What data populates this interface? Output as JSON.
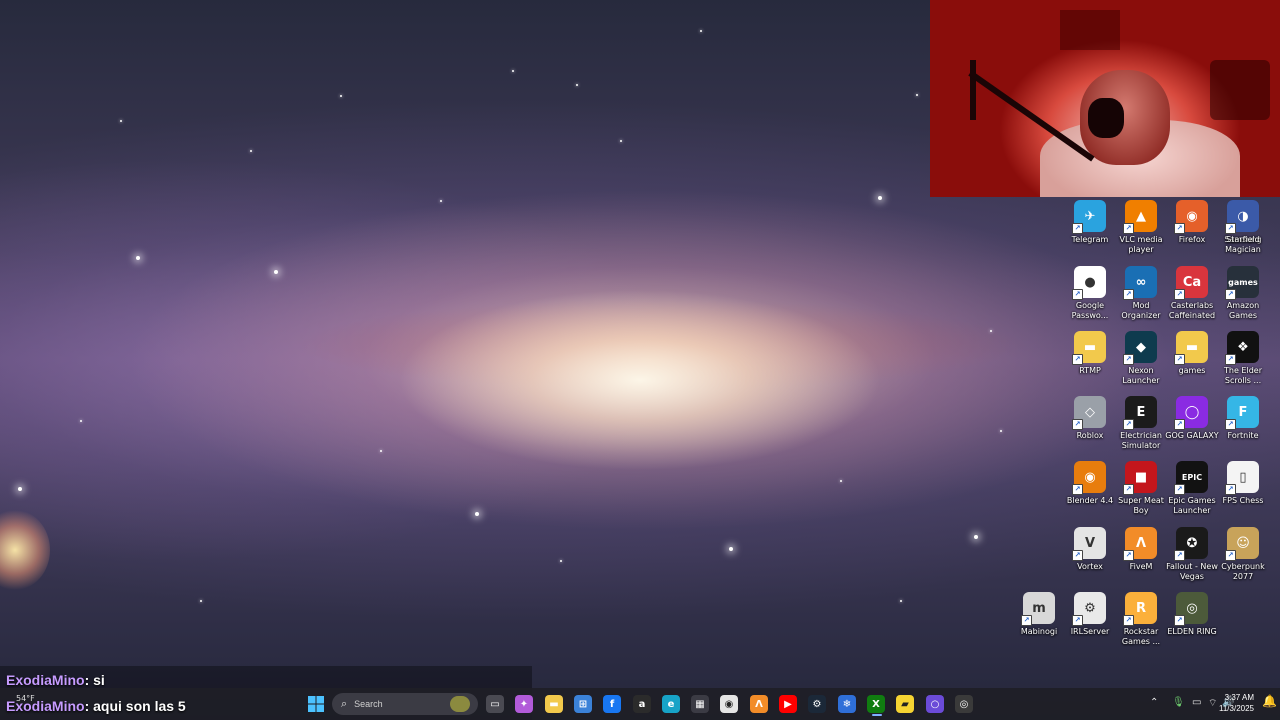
{
  "desktop": {
    "icons": [
      {
        "label": "Telegram",
        "color": "#2aa3df",
        "glyph": "✈"
      },
      {
        "label": "VLC media player",
        "color": "#f07f00",
        "glyph": "▲"
      },
      {
        "label": "Firefox",
        "color": "#e5602a",
        "glyph": "◉"
      },
      {
        "label": "Samsung Magician",
        "color": "#1b2540",
        "glyph": "○"
      },
      {
        "label": "Google Passwo...",
        "color": "#ffffff",
        "glyph": "●"
      },
      {
        "label": "Mod Organizer",
        "color": "#1a6fb4",
        "glyph": "∞"
      },
      {
        "label": "Casterlabs Caffeinated",
        "color": "#d9353d",
        "glyph": "Ca"
      },
      {
        "label": "Amazon Games",
        "color": "#27303b",
        "glyph": "games"
      },
      {
        "label": "RTMP",
        "color": "#f2c94c",
        "glyph": "▬"
      },
      {
        "label": "Nexon Launcher",
        "color": "#0e3b4e",
        "glyph": "◆"
      },
      {
        "label": "games",
        "color": "#f2c94c",
        "glyph": "▬"
      },
      {
        "label": "The Elder Scrolls ...",
        "color": "#111111",
        "glyph": "❖"
      },
      {
        "label": "Roblox",
        "color": "#9aa0a8",
        "glyph": "◇"
      },
      {
        "label": "Electrician Simulator",
        "color": "#1b1b1b",
        "glyph": "E"
      },
      {
        "label": "GOG GALAXY",
        "color": "#8a2be2",
        "glyph": "◯"
      },
      {
        "label": "Fortnite",
        "color": "#35b6e6",
        "glyph": "F"
      },
      {
        "label": "Blender 4.4",
        "color": "#e87d0d",
        "glyph": "◉"
      },
      {
        "label": "Super Meat Boy",
        "color": "#c4161c",
        "glyph": "■"
      },
      {
        "label": "Epic Games Launcher",
        "color": "#121212",
        "glyph": "EPIC"
      },
      {
        "label": "FPS Chess",
        "color": "#f4f4f4",
        "glyph": "▯"
      },
      {
        "label": "Vortex",
        "color": "#e4e4e4",
        "glyph": "V"
      },
      {
        "label": "FiveM",
        "color": "#f28c28",
        "glyph": "Λ"
      },
      {
        "label": "Fallout - New Vegas",
        "color": "#1a1a1a",
        "glyph": "✪"
      },
      {
        "label": "Cyberpunk 2077",
        "color": "#c8a35a",
        "glyph": "☺"
      },
      {
        "label": "Mabinogi",
        "color": "#d8d8d8",
        "glyph": "m"
      },
      {
        "label": "IRLServer",
        "color": "#e9e9e9",
        "glyph": "⚙"
      },
      {
        "label": "Rockstar Games ...",
        "color": "#fbb03b",
        "glyph": "R"
      },
      {
        "label": "ELDEN RING",
        "color": "#4c5a3a",
        "glyph": "◎"
      },
      {
        "label": "Starfield",
        "color": "#3b5aa8",
        "glyph": "◑"
      }
    ]
  },
  "chat": {
    "lines": [
      {
        "user": "ExodiaMino",
        "msg": ": si"
      },
      {
        "user": "ExodiaMino",
        "msg": ": aqui son las 5"
      }
    ]
  },
  "taskbar": {
    "weather": "54°F",
    "search_placeholder": "Search",
    "apps": [
      {
        "name": "task-view",
        "color": "#4a4a52",
        "glyph": "▭"
      },
      {
        "name": "copilot",
        "color": "#b25bd9",
        "glyph": "✦"
      },
      {
        "name": "file-explorer",
        "color": "#f2c94c",
        "glyph": "▬"
      },
      {
        "name": "microsoft-store",
        "color": "#3b82d8",
        "glyph": "⊞"
      },
      {
        "name": "facebook",
        "color": "#1877f2",
        "glyph": "f"
      },
      {
        "name": "amazon",
        "color": "#2b2b2b",
        "glyph": "a"
      },
      {
        "name": "edge",
        "color": "#17a3c7",
        "glyph": "e"
      },
      {
        "name": "calculator",
        "color": "#3b3b44",
        "glyph": "▦"
      },
      {
        "name": "chrome",
        "color": "#e5e5e5",
        "glyph": "◉"
      },
      {
        "name": "fivem",
        "color": "#f28c28",
        "glyph": "Λ"
      },
      {
        "name": "youtube",
        "color": "#ff0000",
        "glyph": "▶"
      },
      {
        "name": "steam",
        "color": "#1b2838",
        "glyph": "⚙"
      },
      {
        "name": "blue-app",
        "color": "#2f6fd8",
        "glyph": "❄"
      },
      {
        "name": "xbox",
        "color": "#107c10",
        "glyph": "X"
      },
      {
        "name": "sticky-notes",
        "color": "#f6d432",
        "glyph": "▰"
      },
      {
        "name": "cortana-app",
        "color": "#6b4bd8",
        "glyph": "○"
      },
      {
        "name": "obs",
        "color": "#3a3a3a",
        "glyph": "◎"
      }
    ],
    "clock_time": "3:37 AM",
    "clock_date": "11/3/2025"
  }
}
